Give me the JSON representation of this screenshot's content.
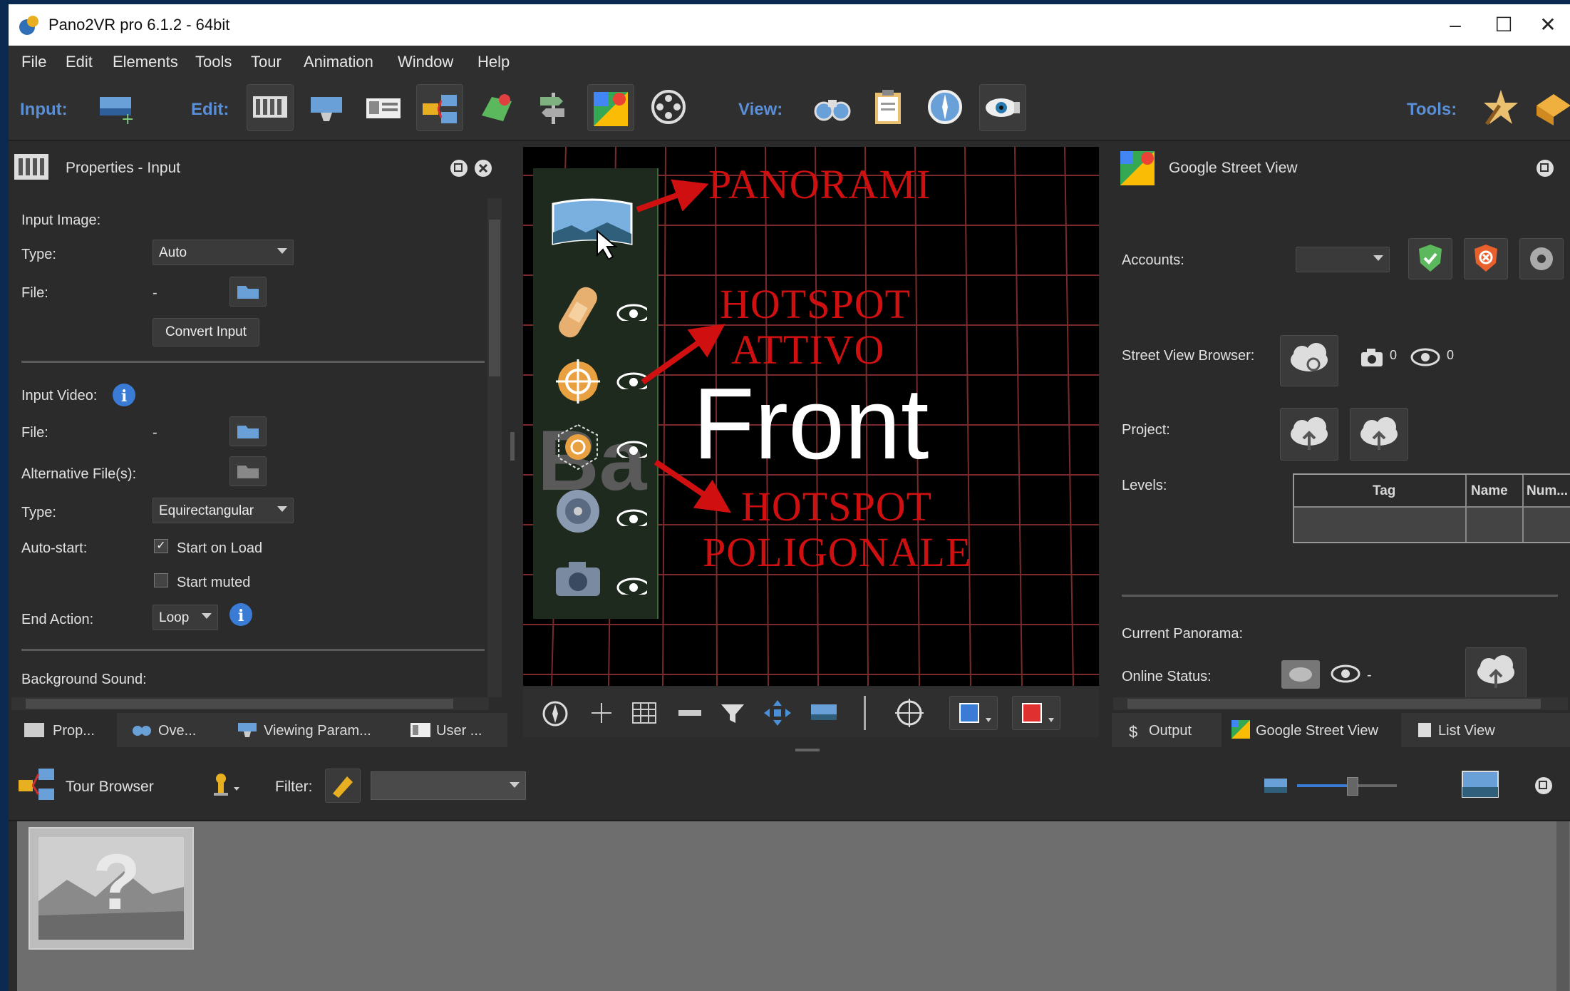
{
  "window": {
    "title": "Pano2VR pro 6.1.2 - 64bit"
  },
  "menu": [
    "File",
    "Edit",
    "Elements",
    "Tools",
    "Tour",
    "Animation",
    "Window",
    "Help"
  ],
  "toolbar": {
    "input_label": "Input:",
    "edit_label": "Edit:",
    "view_label": "View:",
    "tools_label": "Tools:"
  },
  "left_panel": {
    "title": "Properties - Input",
    "input_image": "Input Image:",
    "type_label": "Type:",
    "type_value": "Auto",
    "file_label": "File:",
    "file_value": "-",
    "convert_button": "Convert Input",
    "input_video": "Input Video:",
    "video_file_label": "File:",
    "video_file_value": "-",
    "alt_files_label": "Alternative File(s):",
    "video_type_label": "Type:",
    "video_type_value": "Equirectangular",
    "autostart_label": "Auto-start:",
    "start_on_load": "Start on Load",
    "start_muted": "Start muted",
    "end_action_label": "End Action:",
    "end_action_value": "Loop",
    "background_sound": "Background Sound:",
    "tabs": [
      "Prop...",
      "Ove...",
      "Viewing Param...",
      "User ..."
    ]
  },
  "center": {
    "front_label": "Front",
    "back_partial": "Ba",
    "annotations": {
      "panorami": "PANORAMI",
      "hotspot_attivo_1": "HOTSPOT",
      "hotspot_attivo_2": "ATTIVO",
      "hotspot_pol_1": "HOTSPOT",
      "hotspot_pol_2": "POLIGONALE"
    },
    "annotation_color": "#d01010"
  },
  "right_panel": {
    "title": "Google Street View",
    "accounts_label": "Accounts:",
    "svb_label": "Street View Browser:",
    "photo_count": "0",
    "view_count": "0",
    "project_label": "Project:",
    "levels_label": "Levels:",
    "levels_columns": [
      "Tag",
      "Name",
      "Num..."
    ],
    "current_panorama_label": "Current Panorama:",
    "online_status_label": "Online Status:",
    "online_status_value": "-",
    "tabs": [
      "Output",
      "Google Street View",
      "List View"
    ]
  },
  "tour_browser": {
    "title": "Tour Browser",
    "filter_label": "Filter:",
    "thumb_placeholder": "?"
  }
}
